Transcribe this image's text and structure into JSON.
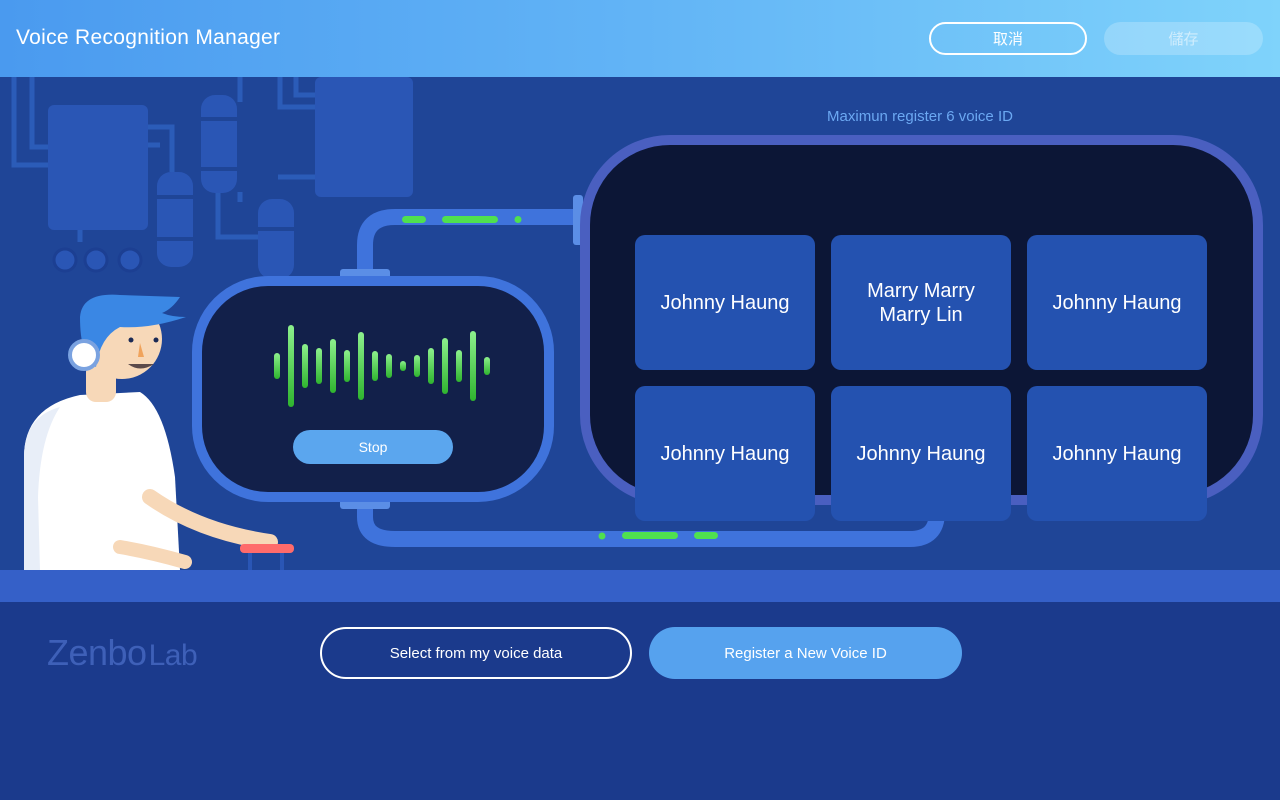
{
  "header": {
    "title": "Voice Recognition Manager",
    "cancel_label": "取消",
    "save_label": "儲存"
  },
  "panel": {
    "limit_text": "Maximun register 6 voice ID",
    "voice_ids": [
      {
        "name": "Johnny Haung"
      },
      {
        "name": "Marry Marry Marry Lin"
      },
      {
        "name": "Johnny Haung"
      },
      {
        "name": "Johnny Haung"
      },
      {
        "name": "Johnny Haung"
      },
      {
        "name": "Johnny Haung"
      }
    ]
  },
  "recorder": {
    "stop_label": "Stop",
    "waveform_levels": [
      0.3,
      0.95,
      0.52,
      0.42,
      0.62,
      0.38,
      0.8,
      0.36,
      0.28,
      0.12,
      0.25,
      0.42,
      0.64,
      0.38,
      0.82,
      0.22
    ]
  },
  "footer": {
    "logo_primary": "Zenbo",
    "logo_secondary": "Lab",
    "select_label": "Select from my voice data",
    "register_label": "Register a New Voice ID"
  },
  "colors": {
    "accent": "#56a2ee",
    "background": "#1b3a8c",
    "wave_green": "#2fb42f"
  }
}
